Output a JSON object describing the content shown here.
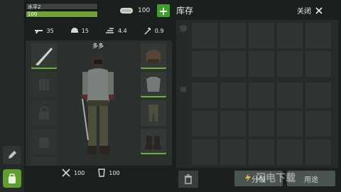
{
  "player": {
    "level_label": "水平2",
    "xp_label": "100",
    "name": "多多"
  },
  "currency": {
    "amount": "100",
    "add_label": "+"
  },
  "stats": [
    {
      "icon": "rifle-icon",
      "value": "35"
    },
    {
      "icon": "helmet-icon",
      "value": "15"
    },
    {
      "icon": "speed-icon",
      "value": "4.4"
    },
    {
      "icon": "axe-icon",
      "value": "0.9"
    }
  ],
  "bottom_stats": [
    {
      "icon": "food-icon",
      "value": "100"
    },
    {
      "icon": "water-icon",
      "value": "100"
    }
  ],
  "inventory": {
    "title": "库存",
    "close_label": "关闭"
  },
  "buttons": {
    "split": "分裂",
    "use": "用途"
  },
  "watermark": "闪电下载",
  "colors": {
    "accent": "#6bb23a",
    "bg": "#1b1f1d",
    "panel": "#2a302d"
  }
}
